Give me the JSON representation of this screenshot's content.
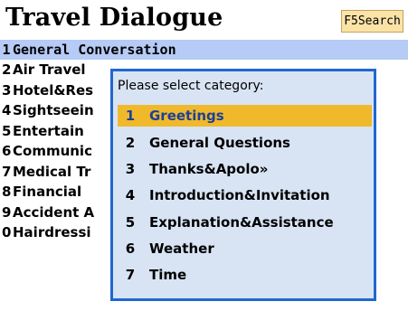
{
  "title": "Travel Dialogue",
  "search_button": "F5Search",
  "menu": {
    "items": [
      {
        "num": "1",
        "label": "General Conversation",
        "selected": true
      },
      {
        "num": "2",
        "label": "Air Travel"
      },
      {
        "num": "3",
        "label": "Hotel&Res"
      },
      {
        "num": "4",
        "label": "Sightseein"
      },
      {
        "num": "5",
        "label": "Entertain"
      },
      {
        "num": "6",
        "label": "Communic"
      },
      {
        "num": "7",
        "label": "Medical Tr"
      },
      {
        "num": "8",
        "label": "Financial"
      },
      {
        "num": "9",
        "label": "Accident A"
      },
      {
        "num": "0",
        "label": "Hairdressi"
      }
    ]
  },
  "popup": {
    "header": "Please select category:",
    "items": [
      {
        "num": "1",
        "label": "Greetings",
        "active": true
      },
      {
        "num": "2",
        "label": "General Questions"
      },
      {
        "num": "3",
        "label": "Thanks&Apolo»"
      },
      {
        "num": "4",
        "label": "Introduction&Invitation"
      },
      {
        "num": "5",
        "label": "Explanation&Assistance"
      },
      {
        "num": "6",
        "label": "Weather"
      },
      {
        "num": "7",
        "label": "Time"
      }
    ]
  },
  "colors": {
    "selected_row": "#b6cbf5",
    "popup_border": "#1f67cf",
    "popup_bg": "#d8e4f4",
    "active_item": "#f0b92b",
    "active_text": "#1b3f99",
    "search_bg": "#fbe3a8"
  }
}
